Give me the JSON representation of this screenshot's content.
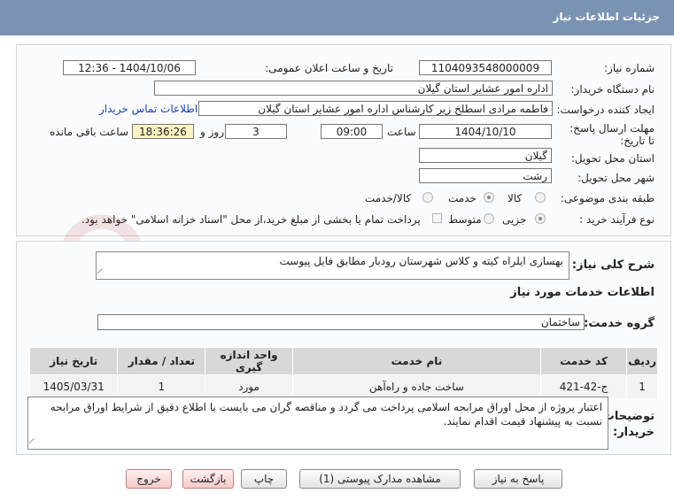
{
  "header": {
    "title": "جزئیات اطلاعات نیاز"
  },
  "form": {
    "need_number_label": "شماره نیاز:",
    "need_number": "1104093548000009",
    "announce_label": "تاریخ و ساعت اعلان عمومی:",
    "announce_value": "1404/10/06 - 12:36",
    "buyer_org_label": "نام دستگاه خریدار:",
    "buyer_org": "اداره امور عشایر استان گیلان",
    "creator_label": "ایجاد کننده درخواست:",
    "creator": "فاطمه مرادی اسطلخ زیر کارشناس اداره امور عشایر استان گیلان",
    "contact_link": "اطلاعات تماس خریدار",
    "deadline_label": "مهلت ارسال پاسخ: تا تاریخ:",
    "deadline_date": "1404/10/10",
    "time_label": "ساعت",
    "deadline_time": "09:00",
    "days_value": "3",
    "days_label": "روز و",
    "remaining_time": "18:36:26",
    "remaining_label": "ساعت باقی مانده",
    "province_label": "استان محل تحویل:",
    "province": "گیلان",
    "city_label": "شهر محل تحویل:",
    "city": "رشت",
    "category_label": "طبقه بندی موضوعی:",
    "category_options": [
      "کالا",
      "خدمت",
      "کالا/خدمت"
    ],
    "category_selected": "خدمت",
    "process_label": "نوع فرآیند خرید :",
    "process_options": [
      "جزیی",
      "متوسط"
    ],
    "process_selected": "جزیی",
    "treasury_note": "پرداخت تمام یا بخشی از مبلغ خرید،از محل \"اسناد خزانه اسلامی\" خواهد بود."
  },
  "description": {
    "label": "شرح کلی نیاز:",
    "text": "بهسازی ایلراه کیته و کلاس شهرستان رودبار مطابق فایل پیوست"
  },
  "services": {
    "section_title": "اطلاعات خدمات مورد نیاز",
    "group_label": "گروه خدمت:",
    "group_value": "ساختمان",
    "columns": [
      "ردیف",
      "کد خدمت",
      "نام خدمت",
      "واحد اندازه گیری",
      "تعداد / مقدار",
      "تاریخ نیاز"
    ],
    "rows": [
      {
        "index": "1",
        "code": "ج-42-421",
        "name": "ساخت جاده و راه‌آهن",
        "unit": "مورد",
        "qty": "1",
        "date": "1405/03/31"
      }
    ]
  },
  "buyer_notes": {
    "label": "توضیحات خریدار:",
    "text": "اعتبار پروژه از محل اوراق مرابحه اسلامی پرداخت می گردد و مناقصه گران می بایست با اطلاع دقیق از شرایط اوراق مرابحه نسبت به پیشنهاد قیمت اقدام نمایند."
  },
  "buttons": {
    "reply": "پاسخ به نیاز",
    "attachments": "مشاهده مدارک پیوستی (1)",
    "print": "چاپ",
    "back": "بازگشت",
    "exit": "خروج"
  },
  "colors": {
    "header_bg": "#7a93b3",
    "remaining_bg": "#fdf3c4",
    "link": "#1a3fb5"
  }
}
